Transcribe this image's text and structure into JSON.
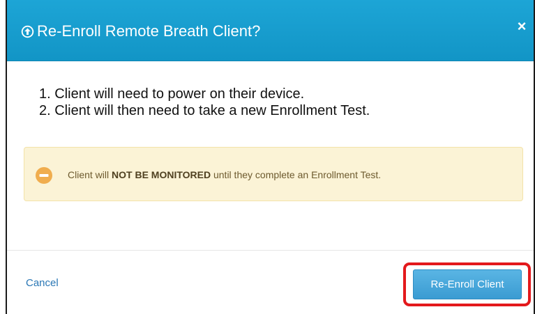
{
  "dialog": {
    "title": "Re-Enroll Remote Breath Client?",
    "close_icon": "close-icon",
    "title_icon": "circle-arrow-up-icon"
  },
  "body": {
    "steps": [
      "1. Client will need to power on their device.",
      "2. Client will then need to take a new Enrollment Test."
    ]
  },
  "alert": {
    "icon": "minus-circle-icon",
    "text_before": "Client will ",
    "text_bold": "NOT BE MONITORED",
    "text_after": " until they complete an Enrollment Test."
  },
  "footer": {
    "cancel_label": "Cancel",
    "confirm_label": "Re-Enroll Client"
  },
  "colors": {
    "header": "#1a9fd0",
    "link": "#2a77b5",
    "primary_button": "#4aa8db",
    "alert_bg": "#fbf3d6",
    "alert_icon": "#f0ad4e",
    "highlight": "#e3191c"
  }
}
